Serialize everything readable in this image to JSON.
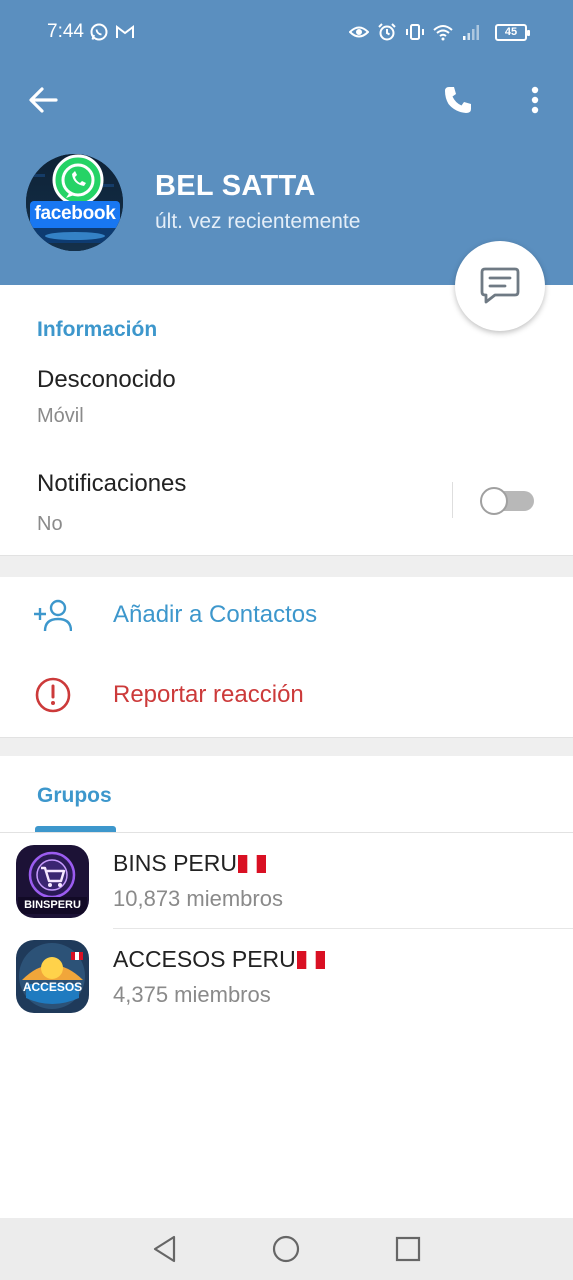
{
  "status_bar": {
    "time": "7:44",
    "battery": "45",
    "left_icons": [
      "whatsapp-icon",
      "gmail-icon"
    ],
    "right_icons": [
      "eye-icon",
      "alarm-icon",
      "vibrate-icon",
      "wifi-icon",
      "signal-icon",
      "battery-icon"
    ]
  },
  "header": {
    "back_icon": "arrow-left-icon",
    "call_icon": "phone-icon",
    "menu_icon": "more-vertical-icon",
    "background_color": "#5b8fbf"
  },
  "profile": {
    "name": "BEL SATTA",
    "status": "últ. vez recientemente",
    "avatar_text": "facebook"
  },
  "info": {
    "title": "Información",
    "phone_value": "Desconocido",
    "phone_label": "Móvil",
    "notifications_label": "Notificaciones",
    "notifications_value": "No",
    "notifications_enabled": false
  },
  "actions": {
    "add_contact": "Añadir a Contactos",
    "report": "Reportar reacción",
    "accent_color": "#3d97cc",
    "danger_color": "#cc3a3a"
  },
  "groups": {
    "tab_label": "Grupos",
    "items": [
      {
        "name": "BINS PERU",
        "members": "10,873 miembros",
        "avatar_text": "BINSPERU"
      },
      {
        "name": "ACCESOS PERU",
        "members": "4,375 miembros",
        "avatar_text": "ACCESOS"
      }
    ]
  },
  "nav": {
    "icons": [
      "nav-back-icon",
      "nav-home-icon",
      "nav-recents-icon"
    ]
  }
}
